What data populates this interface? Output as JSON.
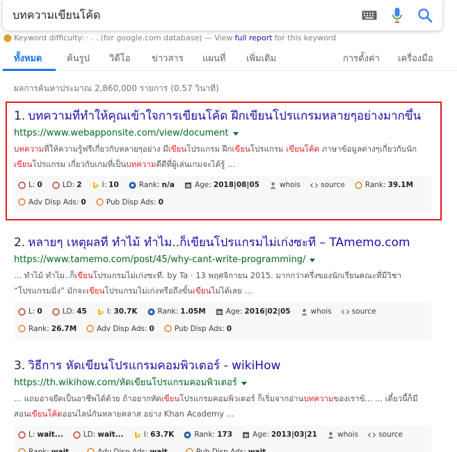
{
  "search": {
    "query": "บทความเขียนโค้ด",
    "icons": [
      "keyboard-icon",
      "microphone-icon",
      "search-icon"
    ]
  },
  "keyword_difficulty": {
    "label": "Keyword difficulty:",
    "value": "· . .",
    "db_text": "(for google.com database) — View",
    "link": "full report",
    "suffix": "for this keyword"
  },
  "tabs": [
    {
      "label": "ทั้งหมด",
      "active": true
    },
    {
      "label": "ค้นรูป"
    },
    {
      "label": "วิดีโอ"
    },
    {
      "label": "ข่าวสาร"
    },
    {
      "label": "แผนที่"
    },
    {
      "label": "เพิ่มเติม"
    },
    {
      "label": "การตั้งค่า"
    },
    {
      "label": "เครื่องมือ"
    }
  ],
  "result_stats": "ผลการค้นหาประมาณ 2,860,000 รายการ (0.57 วินาที)",
  "results": [
    {
      "num": "1.",
      "title": "บทความที่ทำให้คุณเข้าใจการเขียนโค้ด ฝึกเขียนโปรแกรมหลายๆอย่างมากขึ้น",
      "url": "https://www.webapponsite.com/view/document",
      "snippet_segments": [
        {
          "t": "บทความ",
          "em": true
        },
        {
          "t": "ที่ให้ความรู้ฟรีเกี่ยวกับหลายๆอย่าง มี"
        },
        {
          "t": "เขียน",
          "em": true
        },
        {
          "t": "โปรแกรม ฝึก"
        },
        {
          "t": "เขียน",
          "em": true
        },
        {
          "t": "โปรแกรม "
        },
        {
          "t": "เขียนโค้ด",
          "em": true
        },
        {
          "t": " ภาษาข้อมูลต่างๆเกี่ยวกับนัก"
        },
        {
          "t": "เขียน",
          "em": true
        },
        {
          "t": "โปรแกรม เกี่ยวกับเกมที่เป็น"
        },
        {
          "t": "บทความ",
          "em": true
        },
        {
          "t": "ดีดีที่ผู้เล่นเกมจะได้รู้ ..."
        }
      ],
      "metrics": [
        {
          "label": "L:",
          "value": "0",
          "icon": "majestic-icon"
        },
        {
          "label": "LD:",
          "value": "2",
          "icon": "majestic-icon"
        },
        {
          "label": "I:",
          "value": "10",
          "icon": "bing-icon"
        },
        {
          "label": "Rank:",
          "value": "n/a",
          "icon": "alexa-icon"
        },
        {
          "label": "Age:",
          "value": "2018|08|05",
          "icon": "calendar-icon"
        },
        {
          "label": "whois",
          "value": "",
          "icon": "person-icon"
        },
        {
          "label": "source",
          "value": "",
          "icon": "code-icon"
        },
        {
          "label": "Rank:",
          "value": "39.1M",
          "icon": "semrush-icon"
        },
        {
          "label": "Adv Disp Ads:",
          "value": "0",
          "icon": "semrush-icon"
        },
        {
          "label": "Pub Disp Ads:",
          "value": "0",
          "icon": "semrush-icon"
        }
      ]
    },
    {
      "num": "2.",
      "title": "หลายๆ เหตุผลที่ ทำไม้ ทำไม..ก็เขียนโปรแกรมไม่เก่งซะที – TAmemo.com",
      "url": "https://www.tamemo.com/post/45/why-cant-write-programming/",
      "snippet_segments": [
        {
          "t": "... ทำไม้ ทำไม..ก็"
        },
        {
          "t": "เขียน",
          "em": true
        },
        {
          "t": "โปรแกรมไม่เก่งซะที. by Ta · 13 พฤศจิกายน 2015. มากกว่าครึ่งของนักเรียนคณะที่มีวิชา “โปรแกรมมิ่ง” มักจะ"
        },
        {
          "t": "เขียน",
          "em": true
        },
        {
          "t": "โปรแกรมไม่เก่งหรือถึงขั้น"
        },
        {
          "t": "เขียน",
          "em": true
        },
        {
          "t": "ไม่ได้เลย ..."
        }
      ],
      "metrics": [
        {
          "label": "L:",
          "value": "0",
          "icon": "majestic-icon"
        },
        {
          "label": "LD:",
          "value": "45",
          "icon": "majestic-icon"
        },
        {
          "label": "I:",
          "value": "30.7K",
          "icon": "bing-icon"
        },
        {
          "label": "Rank:",
          "value": "1.05M",
          "icon": "alexa-icon"
        },
        {
          "label": "Age:",
          "value": "2016|02|05",
          "icon": "calendar-icon"
        },
        {
          "label": "whois",
          "value": "",
          "icon": "person-icon"
        },
        {
          "label": "source",
          "value": "",
          "icon": "code-icon"
        },
        {
          "label": "Rank:",
          "value": "26.7M",
          "icon": "semrush-icon"
        },
        {
          "label": "Adv Disp Ads:",
          "value": "0",
          "icon": "semrush-icon"
        },
        {
          "label": "Pub Disp Ads:",
          "value": "0",
          "icon": "semrush-icon"
        }
      ]
    },
    {
      "num": "3.",
      "title": "วิธีการ หัดเขียนโปรแกรมคอมพิวเตอร์ - wikiHow",
      "url": "https://th.wikihow.com/หัดเขียนโปรแกรมคอมพิวเตอร์",
      "snippet_segments": [
        {
          "t": "... แถมอาจยึดเป็นอาชีพได้ด้วย ถ้าอยากหัด"
        },
        {
          "t": "เขียน",
          "em": true
        },
        {
          "t": "โปรแกรมคอมพิวเตอร์ ก็เริ่มจากอ่าน"
        },
        {
          "t": "บทความ",
          "em": true
        },
        {
          "t": "ของเราข้... ... เดี๋ยวนี้ก็มีสอน"
        },
        {
          "t": "เขียนโค้ด",
          "em": true
        },
        {
          "t": "ออนไลน์กันหลายคลาส อย่าง Khan Academy ..."
        }
      ],
      "metrics": [
        {
          "label": "L:",
          "value": "wait...",
          "icon": "majestic-icon"
        },
        {
          "label": "LD:",
          "value": "wait...",
          "icon": "majestic-icon"
        },
        {
          "label": "I:",
          "value": "63.7K",
          "icon": "bing-icon"
        },
        {
          "label": "Rank:",
          "value": "173",
          "icon": "alexa-icon"
        },
        {
          "label": "Age:",
          "value": "2013|03|21",
          "icon": "calendar-icon"
        },
        {
          "label": "whois",
          "value": "",
          "icon": "person-icon"
        },
        {
          "label": "source",
          "value": "",
          "icon": "code-icon"
        },
        {
          "label": "Rank:",
          "value": "wait...",
          "icon": "semrush-icon"
        },
        {
          "label": "Adv Disp Ads:",
          "value": "wait...",
          "icon": "semrush-icon"
        },
        {
          "label": "Pub Disp Ads:",
          "value": "wait...",
          "icon": "semrush-icon"
        }
      ]
    }
  ],
  "colors": {
    "link": "#1a0dab",
    "url": "#006621",
    "highlight_box": "#e3191f",
    "active_tab": "#1a73e8",
    "keyword_em": "#dd1f1f"
  }
}
